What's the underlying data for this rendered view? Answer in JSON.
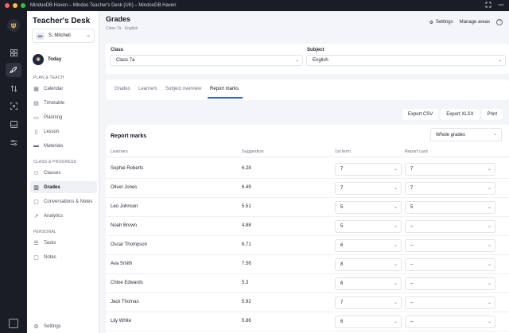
{
  "window": {
    "title": "MindooDB Haven – Mindoo Teacher's Desk (UK) – MindooDB Haven",
    "lights": [
      "#ff5f57",
      "#febc2e",
      "#28c840"
    ]
  },
  "rail": {
    "logo_icon": "owl-logo-icon",
    "items": [
      {
        "icon": "dashboard-icon",
        "active": false
      },
      {
        "icon": "rocket-icon",
        "active": true
      },
      {
        "icon": "swap-icon",
        "active": false
      },
      {
        "icon": "scan-icon",
        "active": false
      },
      {
        "icon": "inbox-icon",
        "active": false
      },
      {
        "icon": "sliders-icon",
        "active": false
      }
    ],
    "bottom_icon": "panel-icon"
  },
  "sidebar": {
    "brand": "Teacher's Desk",
    "user": {
      "initials": "SM",
      "name": "S. Mitchell"
    },
    "today": "Today",
    "sections": [
      {
        "label": "PLAN & TEACH",
        "items": [
          {
            "label": "Calendar",
            "icon": "calendar-icon"
          },
          {
            "label": "Timetable",
            "icon": "grid-icon"
          },
          {
            "label": "Planning",
            "icon": "book-icon"
          },
          {
            "label": "Lesson",
            "icon": "book-open-icon"
          },
          {
            "label": "Materials",
            "icon": "folder-icon"
          }
        ]
      },
      {
        "label": "CLASS & PROGRESS",
        "items": [
          {
            "label": "Classes",
            "icon": "users-icon"
          },
          {
            "label": "Grades",
            "icon": "chart-icon",
            "active": true
          },
          {
            "label": "Conversations & Notes",
            "icon": "chat-icon"
          },
          {
            "label": "Analytics",
            "icon": "trend-icon"
          }
        ]
      },
      {
        "label": "PERSONAL",
        "items": [
          {
            "label": "Tasks",
            "icon": "checklist-icon"
          },
          {
            "label": "Notes",
            "icon": "note-icon"
          }
        ]
      }
    ],
    "settings": "Settings"
  },
  "header": {
    "title": "Grades",
    "subtitle": "Class 7a · English",
    "settings_label": "Settings",
    "manage_label": "Manage areas"
  },
  "filters": {
    "class_label": "Class",
    "class_value": "Class 7a",
    "subject_label": "Subject",
    "subject_value": "English"
  },
  "tabs": [
    {
      "label": "Grades",
      "active": false
    },
    {
      "label": "Learners",
      "active": false
    },
    {
      "label": "Subject overview",
      "active": false
    },
    {
      "label": "Report marks",
      "active": true
    }
  ],
  "export": {
    "csv": "Export CSV",
    "xlsx": "Export XLSX",
    "print": "Print"
  },
  "marks": {
    "title": "Report marks",
    "scope_value": "Whole grades",
    "columns": [
      "Learners",
      "Suggestion",
      "1st term",
      "Report card"
    ],
    "rows": [
      {
        "name": "Sophie Roberts",
        "suggestion": "6.28",
        "term1": "7",
        "report": "7"
      },
      {
        "name": "Oliver Jones",
        "suggestion": "6.49",
        "term1": "7",
        "report": "7"
      },
      {
        "name": "Leo Johnson",
        "suggestion": "5.51",
        "term1": "5",
        "report": "5"
      },
      {
        "name": "Noah Brown",
        "suggestion": "4.88",
        "term1": "5",
        "report": "–"
      },
      {
        "name": "Oscar Thompson",
        "suggestion": "6.71",
        "term1": "6",
        "report": "–"
      },
      {
        "name": "Ava Smith",
        "suggestion": "7.56",
        "term1": "8",
        "report": "–"
      },
      {
        "name": "Chloe Edwards",
        "suggestion": "5.3",
        "term1": "6",
        "report": "–"
      },
      {
        "name": "Jack Thomas",
        "suggestion": "5.92",
        "term1": "7",
        "report": "–"
      },
      {
        "name": "Lily White",
        "suggestion": "5.86",
        "term1": "6",
        "report": "–"
      }
    ]
  }
}
